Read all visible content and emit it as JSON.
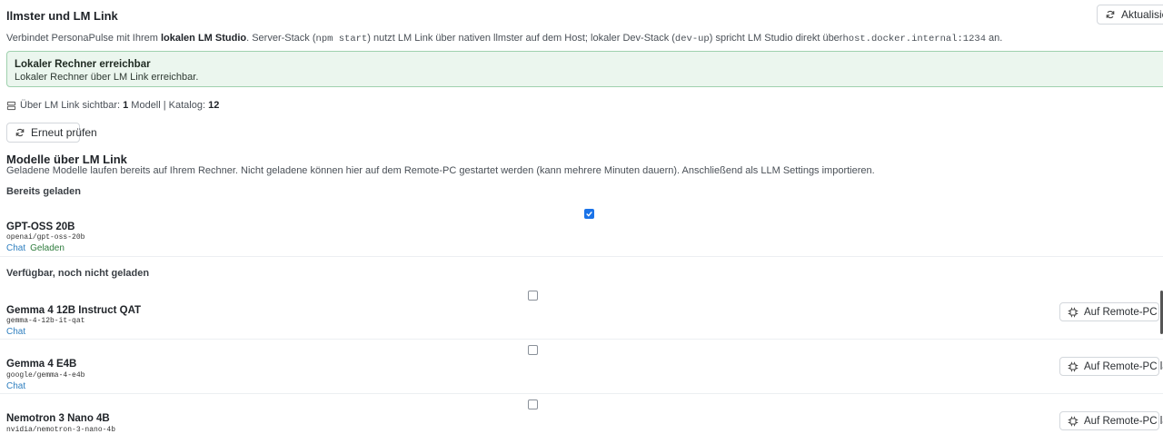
{
  "header": {
    "title": "llmster und LM Link",
    "refresh_label": "Aktualisieren"
  },
  "description": {
    "part1": "Verbindet PersonaPulse mit Ihrem ",
    "bold1": "lokalen LM Studio",
    "part2": ". Server-Stack (",
    "code1": "npm start",
    "part3": ") nutzt LM Link über nativen llmster auf dem Host; lokaler Dev-Stack (",
    "code2": "dev-up",
    "part4": ") spricht LM Studio direkt über",
    "code3": "host.docker.internal:1234",
    "part5": " an."
  },
  "alert": {
    "title": "Lokaler Rechner erreichbar",
    "text": "Lokaler Rechner über LM Link erreichbar."
  },
  "visibility": {
    "prefix": "Über LM Link sichtbar: ",
    "model_count": "1",
    "model_word": " Modell | Katalog: ",
    "catalog_count": "12"
  },
  "recheck_label": "Erneut prüfen",
  "models_section": {
    "title": "Modelle über LM Link",
    "description": "Geladene Modelle laufen bereits auf Ihrem Rechner. Nicht geladene können hier auf dem Remote-PC gestartet werden (kann mehrere Minuten dauern). Anschließend als LLM Settings importieren.",
    "loaded_label": "Bereits geladen",
    "available_label": "Verfügbar, noch nicht geladen",
    "loaded_models": [
      {
        "name": "GPT-OSS 20B",
        "id": "openai/gpt-oss-20b",
        "tag_chat": "Chat",
        "tag_loaded": "Geladen",
        "checked": true
      }
    ],
    "available_models": [
      {
        "name": "Gemma 4 12B Instruct QAT",
        "id": "gemma-4-12b-it-qat",
        "tag_chat": "Chat",
        "button": "Auf Remote-PC laden",
        "checked": false
      },
      {
        "name": "Gemma 4 E4B",
        "id": "google/gemma-4-e4b",
        "tag_chat": "Chat",
        "button": "Auf Remote-PC laden",
        "checked": false
      },
      {
        "name": "Nemotron 3 Nano 4B",
        "id": "nvidia/nemotron-3-nano-4b",
        "tag_chat": "Chat",
        "button": "Auf Remote-PC laden",
        "checked": false
      }
    ]
  },
  "colors": {
    "alert_bg": "#ebf6ee",
    "alert_border": "#9fd1ae",
    "checkbox_checked": "#1a73e8",
    "chat_tag": "#2f7fbf",
    "loaded_tag": "#2f7d3e"
  },
  "icons": {
    "refresh": "refresh-icon",
    "server": "server-icon",
    "chip": "chip-icon"
  }
}
